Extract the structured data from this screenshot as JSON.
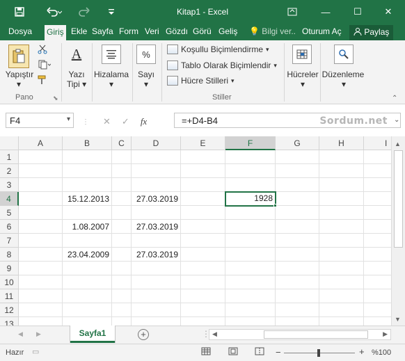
{
  "titlebar": {
    "title": "Kitap1 - Excel",
    "save_icon": "save-icon",
    "undo_icon": "undo-icon",
    "redo_icon": "redo-icon",
    "customize_icon": "customize-qat-icon",
    "ribbon_display_icon": "ribbon-display-icon",
    "minimize_glyph": "—",
    "maximize_glyph": "☐",
    "close_glyph": "✕"
  },
  "tabs": {
    "items": [
      "Dosya",
      "Giriş",
      "Ekle",
      "Sayfa",
      "Form",
      "Veri",
      "Gözdı",
      "Görü",
      "Geliş"
    ],
    "tell_me": "Bilgi ver..",
    "sign_in": "Oturum Aç",
    "share": "Paylaş"
  },
  "ribbon": {
    "paste": "Yapıştır",
    "clipboard_group": "Pano",
    "font_label_1": "Yazı",
    "font_label_2": "Tipi",
    "alignment": "Hizalama",
    "number": "Sayı",
    "percent_glyph": "%",
    "conditional_formatting": "Koşullu Biçimlendirme",
    "format_as_table": "Tablo Olarak Biçimlendir",
    "cell_styles": "Hücre Stilleri",
    "styles_group": "Stiller",
    "cells": "Hücreler",
    "editing": "Düzenleme"
  },
  "formula_bar": {
    "name_box": "F4",
    "cancel_glyph": "✕",
    "enter_glyph": "✓",
    "fx_glyph": "fx",
    "formula": "=+D4-B4",
    "watermark": "Sordum.net"
  },
  "grid": {
    "columns": [
      "A",
      "B",
      "C",
      "D",
      "E",
      "F",
      "G",
      "H",
      "I"
    ],
    "rows": [
      "1",
      "2",
      "3",
      "4",
      "5",
      "6",
      "7",
      "8",
      "9",
      "10",
      "11",
      "12",
      "13"
    ],
    "cells": {
      "B4": "15.12.2013",
      "D4": "27.03.2019",
      "F4": "1928",
      "B6": "1.08.2007",
      "D6": "27.03.2019",
      "B8": "23.04.2009",
      "D8": "27.03.2019"
    },
    "active_cell": "F4"
  },
  "sheets": {
    "tabs": [
      "Sayfa1"
    ],
    "add_glyph": "+"
  },
  "status": {
    "ready": "Hazır",
    "zoom": "%100",
    "zoom_out": "−",
    "zoom_in": "+",
    "zoom_fraction": 0.5
  },
  "colors": {
    "accent": "#217346"
  }
}
